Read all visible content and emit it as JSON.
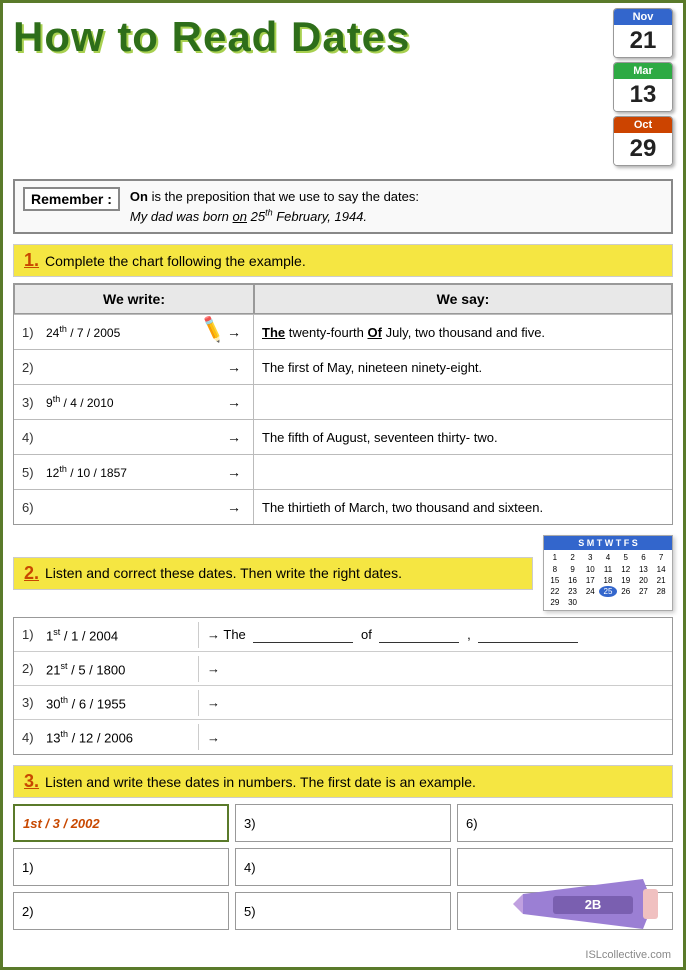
{
  "title": "How to Read Dates",
  "calendars": [
    {
      "month": "Nov",
      "day": "21",
      "type": "nov"
    },
    {
      "month": "Mar",
      "day": "13",
      "type": "mar"
    },
    {
      "month": "Oct",
      "day": "29",
      "type": "oct"
    }
  ],
  "remember": {
    "label": "Remember :",
    "text1": "On is the preposition that we use to say the dates:",
    "text2": "My dad was born on 25",
    "text2_sup": "th",
    "text2_end": " February, 1944."
  },
  "section1": {
    "number": "1.",
    "instruction": "Complete the chart following the example.",
    "col_write": "We write:",
    "col_say": "We say:",
    "rows": [
      {
        "num": "1)",
        "date": "24th / 7 / 2005",
        "date_sup": "th",
        "say": "The twenty-fourth Of July, two thousand and five.",
        "say_the": "The",
        "say_of": "Of"
      },
      {
        "num": "2)",
        "date": "",
        "say": "The first of May, nineteen ninety-eight."
      },
      {
        "num": "3)",
        "date": "9th / 4 / 2010",
        "date_sup": "th",
        "say": ""
      },
      {
        "num": "4)",
        "date": "",
        "say": "The fifth of August, seventeen thirty- two."
      },
      {
        "num": "5)",
        "date": "12th / 10 / 1857",
        "date_sup": "th",
        "say": ""
      },
      {
        "num": "6)",
        "date": "",
        "say": "The thirtieth of March, two thousand and sixteen."
      }
    ]
  },
  "section2": {
    "number": "2.",
    "instruction": "Listen and correct these dates. Then write the right dates.",
    "mini_calendar_days": [
      "1",
      "2",
      "3",
      "4",
      "5",
      "6",
      "7",
      "8",
      "9",
      "10",
      "11",
      "12",
      "13",
      "14",
      "15",
      "16",
      "17",
      "18",
      "19",
      "20",
      "21",
      "22",
      "23",
      "24",
      "25",
      "26",
      "27",
      "28",
      "29",
      "30"
    ],
    "rows": [
      {
        "num": "1)",
        "date": "1st / 1 / 2004",
        "date_sup": "st",
        "say": "→ The ___________ of ___________ , ___________"
      },
      {
        "num": "2)",
        "date": "21st / 5 / 1800",
        "date_sup": "st",
        "say": "→"
      },
      {
        "num": "3)",
        "date": "30th / 6 / 1955",
        "date_sup": "th",
        "say": "→"
      },
      {
        "num": "4)",
        "date": "13th / 12 / 2006",
        "date_sup": "th",
        "say": "→"
      }
    ]
  },
  "section3": {
    "number": "3.",
    "instruction": "Listen and write these dates in numbers. The first date is an example.",
    "cells": [
      {
        "id": "example",
        "value": "1st / 3 / 2002",
        "label": ""
      },
      {
        "id": "3",
        "value": "3)",
        "label": ""
      },
      {
        "id": "6",
        "value": "6)",
        "label": ""
      },
      {
        "id": "1",
        "value": "1)",
        "label": ""
      },
      {
        "id": "4",
        "value": "4)",
        "label": ""
      },
      {
        "id": "empty1",
        "value": "",
        "label": ""
      },
      {
        "id": "2",
        "value": "2)",
        "label": ""
      },
      {
        "id": "5",
        "value": "5)",
        "label": ""
      },
      {
        "id": "empty2",
        "value": "",
        "label": ""
      }
    ]
  },
  "watermark": "ISLcollective.com"
}
